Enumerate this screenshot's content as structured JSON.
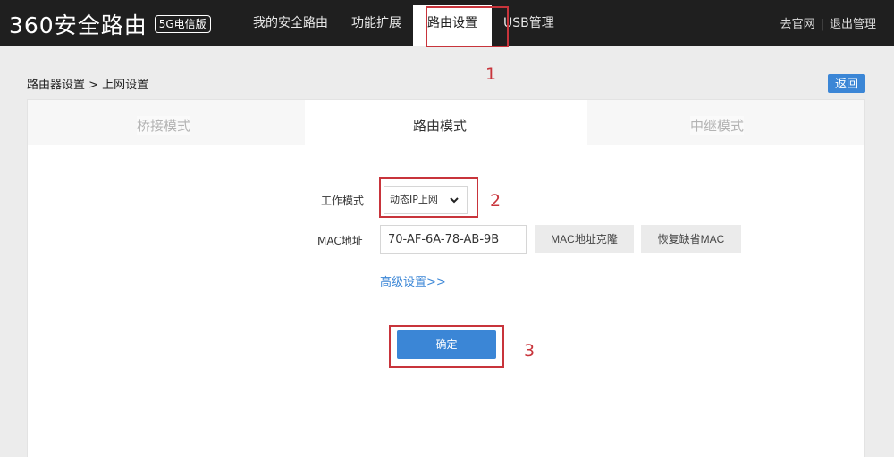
{
  "header": {
    "logo_text": "360安全路由",
    "logo_badge": "5G电信版",
    "nav": [
      "我的安全路由",
      "功能扩展",
      "路由设置",
      "USB管理"
    ],
    "active_nav": "路由设置",
    "right_links": [
      "去官网",
      "退出管理"
    ],
    "separator": "|"
  },
  "breadcrumb": "路由器设置 > 上网设置",
  "back_button": "返回",
  "mode_tabs": [
    "桥接模式",
    "路由模式",
    "中继模式"
  ],
  "active_mode": "路由模式",
  "form": {
    "work_mode_label": "工作模式",
    "work_mode_value": "动态IP上网",
    "mac_label": "MAC地址",
    "mac_value": "70-AF-6A-78-AB-9B",
    "mac_clone_button": "MAC地址克隆",
    "mac_restore_button": "恢复缺省MAC",
    "advanced_link": "高级设置>>",
    "confirm_button": "确定"
  },
  "annotations": [
    "1",
    "2",
    "3"
  ],
  "colors": {
    "header_bg": "#1f1f1f",
    "accent_blue": "#3b86d6",
    "annotation_red": "#c8343b"
  }
}
